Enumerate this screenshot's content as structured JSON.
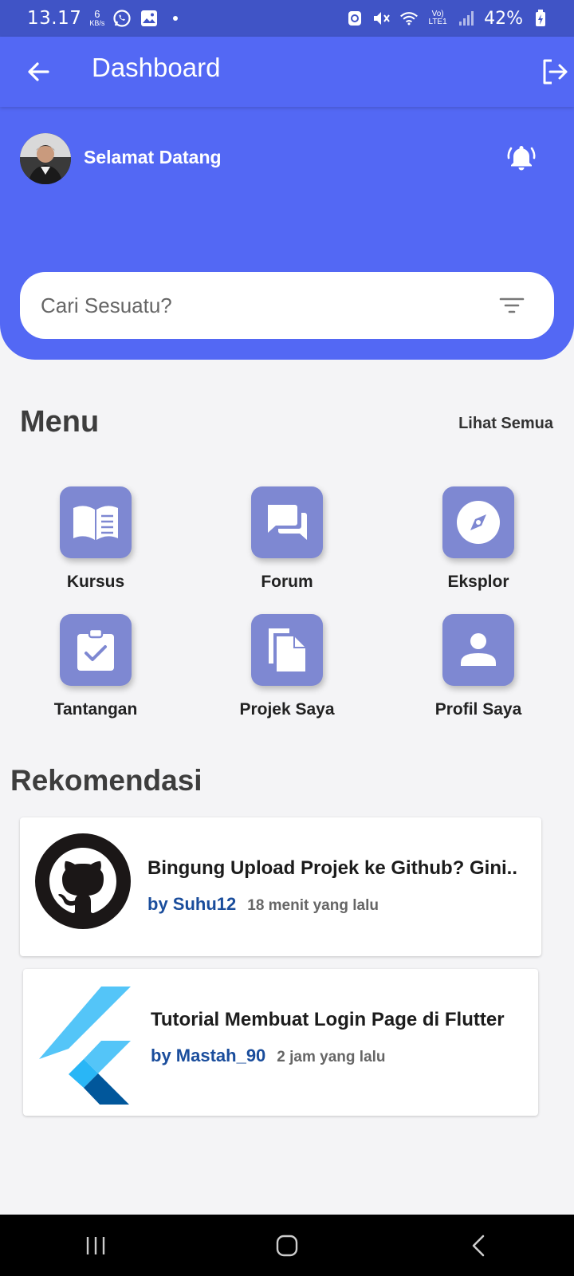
{
  "status_bar": {
    "time": "13.17",
    "net_speed_value": "6",
    "net_speed_unit": "KB/s",
    "network_label": "Vo) LTE1",
    "battery": "42%"
  },
  "app_bar": {
    "title": "Dashboard"
  },
  "header": {
    "welcome": "Selamat Datang",
    "search_placeholder": "Cari Sesuatu?"
  },
  "menu": {
    "title": "Menu",
    "see_all": "Lihat Semua",
    "items": [
      {
        "label": "Kursus",
        "icon": "book-icon"
      },
      {
        "label": "Forum",
        "icon": "forum-icon"
      },
      {
        "label": "Eksplor",
        "icon": "compass-icon"
      },
      {
        "label": "Tantangan",
        "icon": "clipboard-check-icon"
      },
      {
        "label": "Projek Saya",
        "icon": "files-icon"
      },
      {
        "label": "Profil Saya",
        "icon": "person-icon"
      }
    ]
  },
  "recommendations": {
    "title": "Rekomendasi",
    "items": [
      {
        "headline": "Bingung Upload Projek ke Github? Gini..",
        "author": "by Suhu12",
        "time": "18 menit yang lalu",
        "thumb": "github-logo"
      },
      {
        "headline": "Tutorial Membuat Login Page di Flutter",
        "author": "by Mastah_90",
        "time": "2 jam yang lalu",
        "thumb": "flutter-logo"
      }
    ]
  },
  "colors": {
    "primary": "#5368f4",
    "status_bar": "#4054c6",
    "menu_tile": "#7e88d2",
    "author_link": "#1a4d9c"
  }
}
